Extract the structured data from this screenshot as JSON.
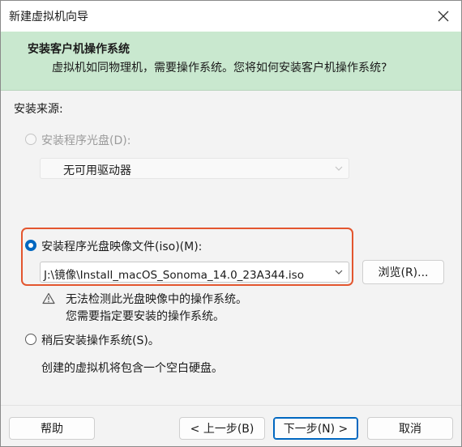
{
  "window": {
    "title": "新建虚拟机向导"
  },
  "header": {
    "title": "安装客户机操作系统",
    "subtitle": "虚拟机如同物理机，需要操作系统。您将如何安装客户机操作系统?"
  },
  "source_label": "安装来源:",
  "options": {
    "disc": {
      "label": "安装程序光盘(D):",
      "dropdown_value": "无可用驱动器",
      "enabled": false,
      "selected": false
    },
    "iso": {
      "label": "安装程序光盘映像文件(iso)(M):",
      "path_value": "J:\\镜像\\Install_macOS_Sonoma_14.0_23A344.iso",
      "browse_label": "浏览(R)...",
      "selected": true
    },
    "later": {
      "label": "稍后安装操作系统(S)。",
      "description": "创建的虚拟机将包含一个空白硬盘。",
      "selected": false
    }
  },
  "warning": {
    "icon": "warning-triangle-icon",
    "line1": "无法检测此光盘映像中的操作系统。",
    "line2": "您需要指定要安装的操作系统。"
  },
  "footer": {
    "help": "帮助",
    "back": "< 上一步(B)",
    "next": "下一步(N) >",
    "cancel": "取消"
  },
  "colors": {
    "header_bg": "#c9e8cf",
    "accent": "#0067c0",
    "highlight": "#e3562f"
  }
}
